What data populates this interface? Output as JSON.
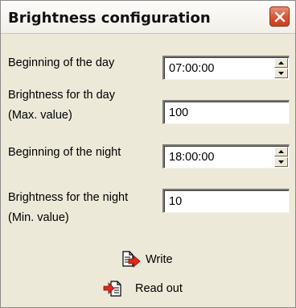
{
  "window": {
    "title": "Brightness configuration"
  },
  "icons": {
    "close": "close-icon",
    "write": "write-icon",
    "read_out": "read-out-icon",
    "spin_up": "spin-up-icon",
    "spin_down": "spin-down-icon"
  },
  "colors": {
    "close_button": "#d75535",
    "dialog_background": "#ece9d8",
    "arrow_red": "#e0281c"
  },
  "fields": {
    "day_start": {
      "label": "Beginning of the day",
      "value": "07:00:00"
    },
    "day_brightness": {
      "label_line1": "Brightness for th day",
      "label_line2": "(Max. value)",
      "value": "100"
    },
    "night_start": {
      "label": "Beginning  of the night",
      "value": "18:00:00"
    },
    "night_brightness": {
      "label_line1": "Brightness for the night",
      "label_line2": "(Min. value)",
      "value": "10"
    }
  },
  "actions": {
    "write": "Write",
    "read_out": "Read out"
  }
}
